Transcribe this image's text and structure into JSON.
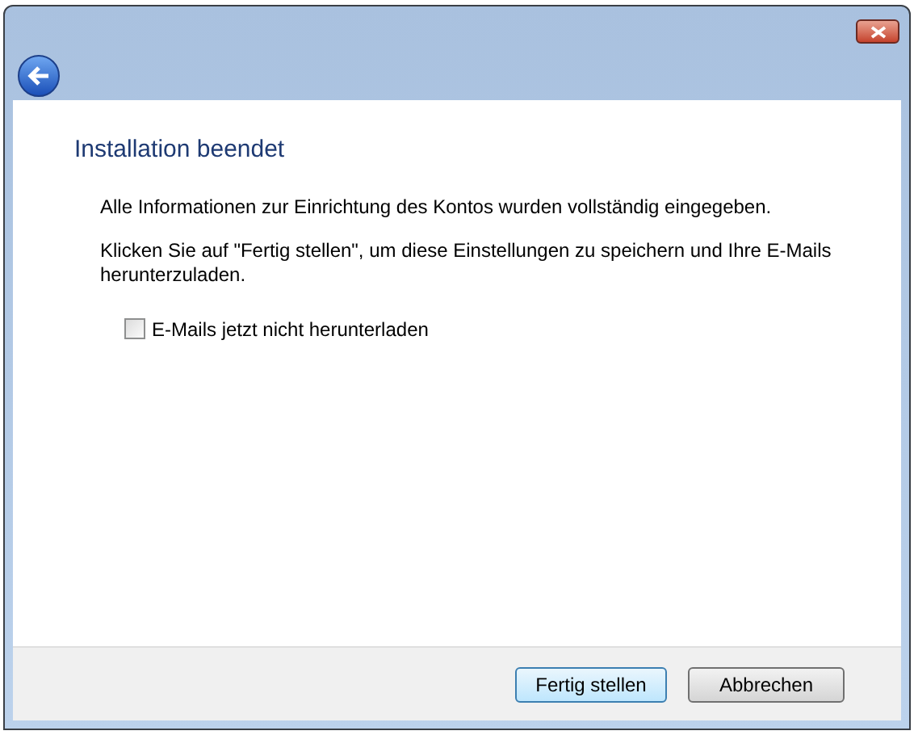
{
  "heading": "Installation beendet",
  "paragraphs": [
    "Alle Informationen zur Einrichtung des Kontos wurden vollständig eingegeben.",
    "Klicken Sie auf \"Fertig stellen\", um diese Einstellungen zu speichern und Ihre E-Mails herunterzuladen."
  ],
  "option": {
    "label": "E-Mails jetzt nicht herunterladen",
    "checked": false
  },
  "buttons": [
    {
      "label": "Fertig stellen",
      "kind": "default"
    },
    {
      "label": "Abbrechen",
      "kind": "normal"
    }
  ]
}
